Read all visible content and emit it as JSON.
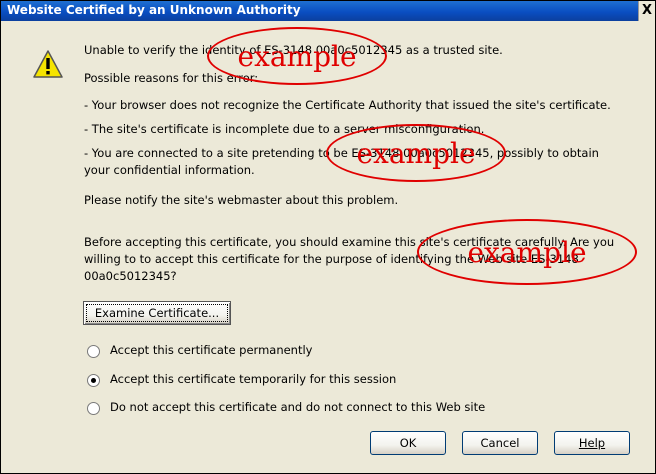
{
  "dialog": {
    "title": "Website Certified by an Unknown Authority",
    "close_glyph": "X"
  },
  "icons": {
    "warning": "warning-triangle-icon"
  },
  "body": {
    "line1": "Unable to verify the identity of ES-3148 00a0c5012345 as a trusted site.",
    "reasons_heading": "Possible reasons for this error:",
    "reason1": "- Your browser does not recognize the Certificate Authority that issued the site's certificate.",
    "reason2": "- The site's certificate is incomplete due to a server misconfiguration.",
    "reason3a": "- You are connected to a site pretending to be ES-3148 00a0c5012345, possibly to obtain",
    "reason3b": "your confidential information.",
    "notify": "Please notify the site's webmaster about this problem.",
    "examine_a": "Before accepting this certificate, you should examine this site's certificate carefully. Are you",
    "examine_b": "willing to to accept this certificate for the purpose of identifying the Web site ES-3148",
    "examine_c": "00a0c5012345?"
  },
  "buttons": {
    "examine": "Examine Certificate...",
    "ok": "OK",
    "cancel": "Cancel",
    "help": "Help"
  },
  "options": [
    {
      "label": "Accept this certificate permanently",
      "selected": false
    },
    {
      "label": "Accept this certificate temporarily for this session",
      "selected": true
    },
    {
      "label": "Do not accept this certificate and do not connect to this Web site",
      "selected": false
    }
  ],
  "annotations": {
    "stamp1": "example",
    "stamp2": "example",
    "stamp3": "example",
    "color": "#e00000"
  }
}
